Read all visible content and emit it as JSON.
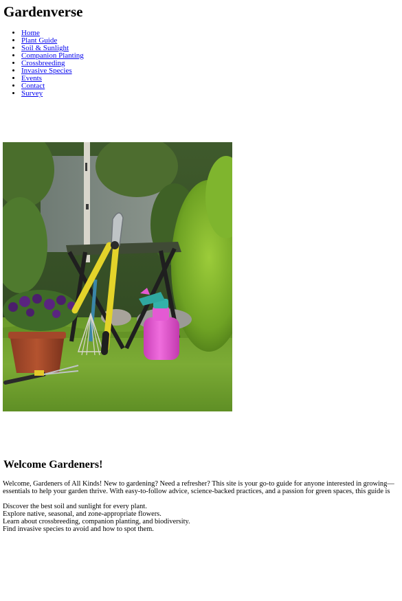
{
  "site": {
    "title": "Gardenverse"
  },
  "nav": {
    "items": [
      {
        "label": "Home"
      },
      {
        "label": "Plant Guide"
      },
      {
        "label": "Soil & Sunlight"
      },
      {
        "label": "Companion Planting"
      },
      {
        "label": "Crossbreeding"
      },
      {
        "label": "Invasive Species"
      },
      {
        "label": "Events"
      },
      {
        "label": "Contact"
      },
      {
        "label": "Survey"
      }
    ],
    "link_color": "#0000ee"
  },
  "hero": {
    "icon": "garden-tools-photo"
  },
  "welcome": {
    "heading": "Welcome Gardeners!",
    "intro_line_1": "Welcome, Gardeners of All Kinds! New to gardening? Need a refresher? This site is your go-to guide for anyone interested in growing—",
    "intro_line_2": "essentials to help your garden thrive. With easy-to-follow advice, science-backed practices, and a passion for green spaces, this guide is",
    "points": [
      "Discover the best soil and sunlight for every plant.",
      "Explore native, seasonal, and zone-appropriate flowers.",
      "Learn about crossbreeding, companion planting, and biodiversity.",
      "Find invasive species to avoid and how to spot them."
    ]
  }
}
